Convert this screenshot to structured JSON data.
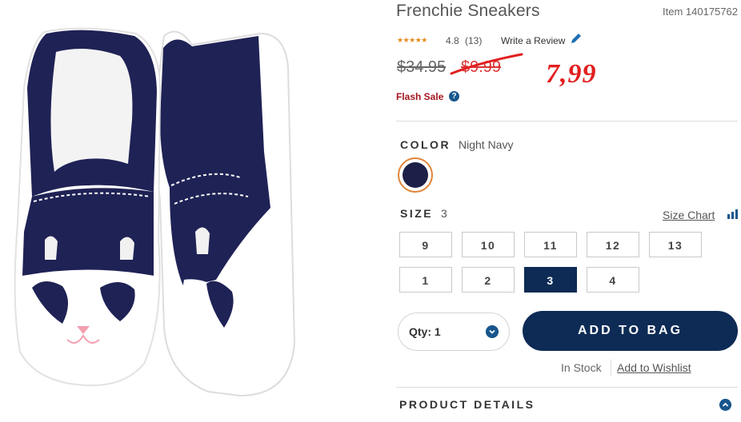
{
  "product": {
    "title": "Frenchie Sneakers",
    "item_number": "Item 140175762",
    "stars_glyph": "★★★★★",
    "rating": "4.8",
    "review_count": "(13)",
    "write_review": "Write a Review"
  },
  "price": {
    "original": "$34.95",
    "sale": "$9.99",
    "handwritten": "7,99",
    "flash_sale": "Flash Sale",
    "help_glyph": "?"
  },
  "color": {
    "label": "COLOR",
    "value": "Night Navy",
    "swatch_hex": "#1c1f47"
  },
  "size": {
    "label": "SIZE",
    "value": "3",
    "chart_link": "Size Chart",
    "options": [
      "9",
      "10",
      "11",
      "12",
      "13",
      "1",
      "2",
      "3",
      "4"
    ],
    "selected": "3"
  },
  "purchase": {
    "qty_label": "Qty: 1",
    "add_to_bag": "ADD TO BAG",
    "in_stock": "In Stock",
    "wishlist": "Add to Wishlist"
  },
  "details": {
    "label": "PRODUCT DETAILS"
  },
  "colors": {
    "navy": "#0d2b55",
    "accent_blue": "#17568c",
    "flash_red": "#a3161f",
    "handwritten_red": "#e21f1f",
    "swatch_ring": "#e0853a"
  }
}
